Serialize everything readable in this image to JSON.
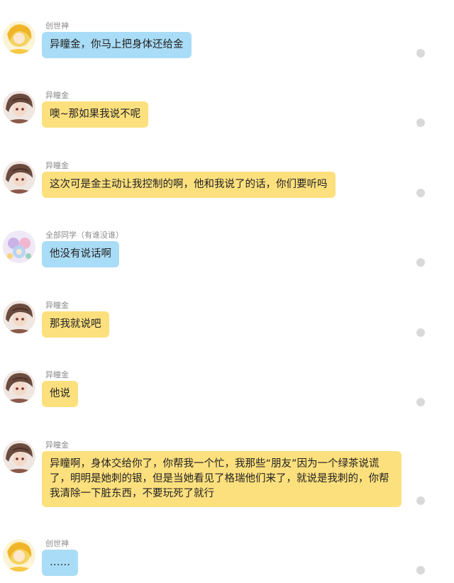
{
  "colors": {
    "yellow_bubble": "#fde07e",
    "blue_bubble": "#a9dcf6",
    "name_text": "#8c8c8c",
    "status_dot": "#d9d9d9"
  },
  "messages": [
    {
      "sender": "创世神",
      "text": "异瞳金，你马上把身体还给金",
      "bubble": "blue",
      "avatar": "golden-hair-avatar"
    },
    {
      "sender": "异瞳金",
      "text": "噢~那如果我说不呢",
      "bubble": "yellow",
      "avatar": "brown-hair-avatar"
    },
    {
      "sender": "异瞳金",
      "text": "这次可是金主动让我控制的啊，他和我说了的话，你们要听吗",
      "bubble": "yellow",
      "avatar": "brown-hair-avatar"
    },
    {
      "sender": "全部同学（有谁没谁）",
      "text": "他没有说话啊",
      "bubble": "blue",
      "avatar": "group-avatar"
    },
    {
      "sender": "异瞳金",
      "text": "那我就说吧",
      "bubble": "yellow",
      "avatar": "brown-hair-avatar"
    },
    {
      "sender": "异瞳金",
      "text": "他说",
      "bubble": "yellow",
      "avatar": "brown-hair-avatar"
    },
    {
      "sender": "异瞳金",
      "text": "异瞳啊，身体交给你了，你帮我一个忙，我那些“朋友”因为一个绿茶说谎了，明明是她刺的银，但是当她看见了格瑞他们来了，就说是我刺的，你帮我清除一下脏东西，不要玩死了就行",
      "bubble": "yellow",
      "avatar": "brown-hair-avatar"
    },
    {
      "sender": "创世神",
      "text": "……",
      "bubble": "blue",
      "avatar": "golden-hair-avatar"
    }
  ]
}
